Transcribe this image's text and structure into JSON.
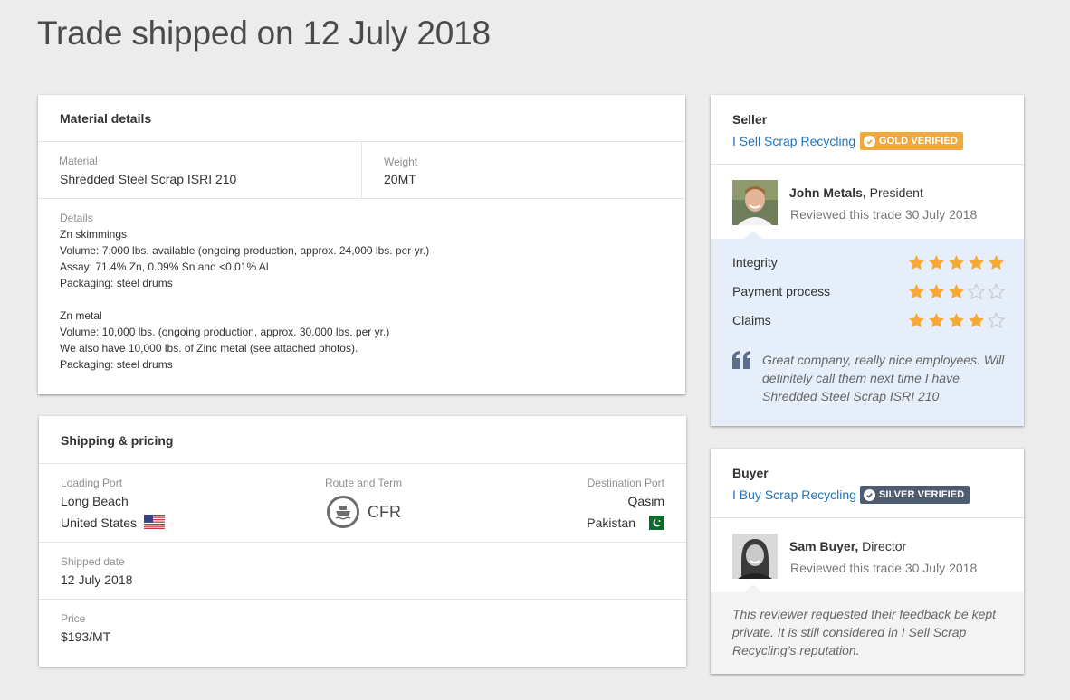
{
  "page": {
    "title": "Trade shipped on 12 July 2018"
  },
  "material": {
    "heading": "Material details",
    "material_label": "Material",
    "material_value": "Shredded Steel Scrap ISRI 210",
    "weight_label": "Weight",
    "weight_value": "20MT",
    "details_label": "Details",
    "details_lines": [
      "Zn skimmings",
      "Volume: 7,000 lbs. available (ongoing production, approx. 24,000 lbs. per yr.)",
      "Assay: 71.4% Zn, 0.09% Sn and <0.01% Al",
      "Packaging: steel drums",
      "",
      "Zn metal",
      "Volume: 10,000 lbs. (ongoing production, approx. 30,000 lbs. per yr.)",
      "We also have 10,000 lbs. of Zinc metal (see attached photos).",
      "Packaging: steel drums"
    ]
  },
  "shipping": {
    "heading": "Shipping & pricing",
    "loading_port_label": "Loading Port",
    "loading_port_city": "Long Beach",
    "loading_port_country": "United States",
    "route_label": "Route and Term",
    "route_term": "CFR",
    "destination_label": "Destination Port",
    "destination_city": "Qasim",
    "destination_country": "Pakistan",
    "shipped_label": "Shipped date",
    "shipped_value": "12 July 2018",
    "price_label": "Price",
    "price_value": "$193/MT"
  },
  "seller": {
    "heading": "Seller",
    "company": "I Sell Scrap Recycling",
    "badge": "GOLD VERIFIED",
    "badge_color": "#f2a93b",
    "reviewer_name": "John Metals,",
    "reviewer_title": " President",
    "reviewed_text": "Reviewed this trade 30 July 2018",
    "ratings": [
      {
        "label": "Integrity",
        "stars": 5
      },
      {
        "label": "Payment process",
        "stars": 3
      },
      {
        "label": "Claims",
        "stars": 4
      }
    ],
    "quote": "Great company, really nice employees. Will definitely call them next time I have Shredded Steel Scrap ISRI 210"
  },
  "buyer": {
    "heading": "Buyer",
    "company": "I Buy Scrap Recycling",
    "badge": "SILVER VERIFIED",
    "badge_color": "#4f5b6e",
    "reviewer_name": "Sam Buyer,",
    "reviewer_title": " Director",
    "reviewed_text": "Reviewed this trade 30 July 2018",
    "private_note": "This reviewer requested their feedback be kept private. It is still considered in I Sell Scrap Recycling’s reputation."
  },
  "colors": {
    "star": "#f6a935",
    "star_empty": "#c8c8c8",
    "link": "#1f73b7",
    "review_panel": "#e6eef9",
    "private_panel": "#f3f3f3"
  },
  "icons": [
    "ship-icon",
    "us-flag-icon",
    "pakistan-flag-icon",
    "quote-icon",
    "check-icon",
    "star-icon"
  ]
}
